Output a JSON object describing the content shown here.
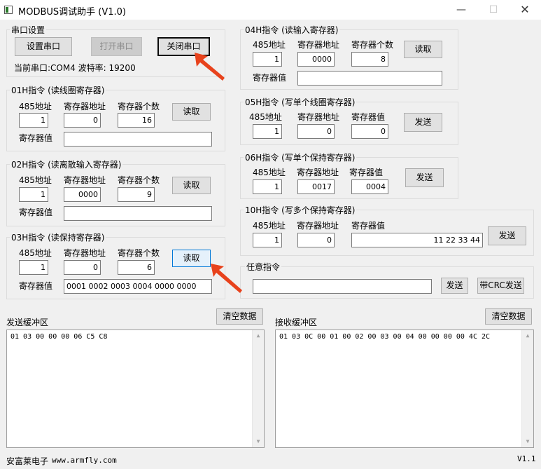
{
  "window": {
    "title": "MODBUS调试助手 (V1.0)",
    "min_glyph": "—",
    "max_glyph": "☐",
    "close_glyph": "✕"
  },
  "serial": {
    "title": "串口设置",
    "setup_label": "设置串口",
    "open_label": "打开串口",
    "close_label": "关闭串口",
    "status": "当前串口:COM4 波特率: 19200"
  },
  "common": {
    "addr485": "485地址",
    "reg_addr": "寄存器地址",
    "reg_count": "寄存器个数",
    "reg_value": "寄存器值",
    "read": "读取",
    "send": "发送"
  },
  "f01": {
    "title": "01H指令 (读线圈寄存器)",
    "addr": "1",
    "reg_addr": "0",
    "count": "16",
    "value": ""
  },
  "f02": {
    "title": "02H指令 (读离散输入寄存器)",
    "addr": "1",
    "reg_addr": "0000",
    "count": "9",
    "value": ""
  },
  "f03": {
    "title": "03H指令 (读保持寄存器)",
    "addr": "1",
    "reg_addr": "0",
    "count": "6",
    "value": "0001 0002 0003 0004 0000 0000"
  },
  "f04": {
    "title": "04H指令 (读输入寄存器)",
    "addr": "1",
    "reg_addr": "0000",
    "count": "8",
    "value": ""
  },
  "f05": {
    "title": "05H指令 (写单个线圈寄存器)",
    "addr": "1",
    "reg_addr": "0",
    "value": "0"
  },
  "f06": {
    "title": "06H指令 (写单个保持寄存器)",
    "addr": "1",
    "reg_addr": "0017",
    "value": "0004"
  },
  "f10": {
    "title": "10H指令 (写多个保持寄存器)",
    "addr": "1",
    "reg_addr": "0",
    "value": "11 22 33 44"
  },
  "custom": {
    "title": "任意指令",
    "value": "",
    "send": "发送",
    "send_crc": "带CRC发送"
  },
  "send_buffer": {
    "label": "发送缓冲区",
    "clear": "清空数据",
    "content": "01 03 00 00 00 06 C5 C8"
  },
  "recv_buffer": {
    "label": "接收缓冲区",
    "clear": "清空数据",
    "content": "01 03 0C 00 01 00 02 00 03 00 04 00 00 00 00 4C 2C"
  },
  "footer": {
    "company": "安富莱电子",
    "url": "www.armfly.com",
    "version": "V1.1"
  },
  "colors": {
    "annotation_arrow": "#e8421c",
    "focus_blue": "#0078d7"
  }
}
